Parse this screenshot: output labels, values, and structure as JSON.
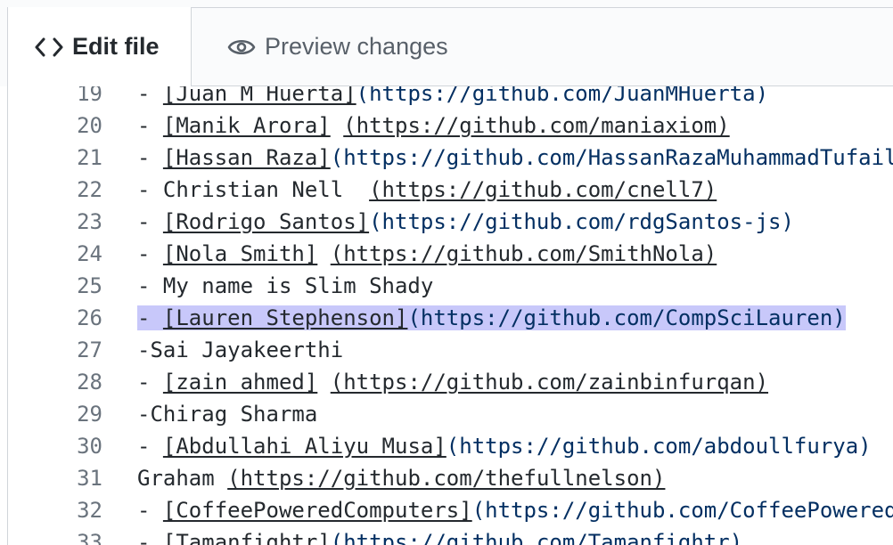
{
  "tabs": {
    "edit_label": "Edit file",
    "preview_label": "Preview changes"
  },
  "lines": [
    {
      "num": "19",
      "pre": "- ",
      "link": "[Juan M Huerta]",
      "mid": "",
      "url": "(https://github.com/JuanMHuerta)",
      "url_style": "url"
    },
    {
      "num": "20",
      "pre": "- ",
      "link": "[Manik Arora]",
      "mid": " ",
      "url": "(https://github.com/maniaxiom)",
      "url_style": "plain-underline"
    },
    {
      "num": "21",
      "pre": "- ",
      "link": "[Hassan Raza]",
      "mid": "",
      "url": "(https://github.com/HassanRazaMuhammadTufail)",
      "url_style": "url"
    },
    {
      "num": "22",
      "pre": "- Christian Nell  ",
      "link": "",
      "mid": "",
      "url": "(https://github.com/cnell7)",
      "url_style": "plain-underline"
    },
    {
      "num": "23",
      "pre": "- ",
      "link": "[Rodrigo Santos]",
      "mid": "",
      "url": "(https://github.com/rdgSantos-js)",
      "url_style": "url"
    },
    {
      "num": "24",
      "pre": "- ",
      "link": "[Nola Smith]",
      "mid": " ",
      "url": "(https://github.com/SmithNola)",
      "url_style": "plain-underline"
    },
    {
      "num": "25",
      "pre": "- My name is Slim Shady",
      "link": "",
      "mid": "",
      "url": "",
      "url_style": "none"
    },
    {
      "num": "26",
      "pre": "- ",
      "link": "[Lauren Stephenson]",
      "mid": "",
      "url": "(https://github.com/CompSciLauren)",
      "url_style": "url",
      "highlighted": true
    },
    {
      "num": "27",
      "pre": "-Sai Jayakeerthi",
      "link": "",
      "mid": "",
      "url": "",
      "url_style": "none"
    },
    {
      "num": "28",
      "pre": "- ",
      "link": "[zain ahmed]",
      "mid": " ",
      "url": "(https://github.com/zainbinfurqan)",
      "url_style": "plain-underline"
    },
    {
      "num": "29",
      "pre": "-Chirag Sharma",
      "link": "",
      "mid": "",
      "url": "",
      "url_style": "none"
    },
    {
      "num": "30",
      "pre": "- ",
      "link": "[Abdullahi Aliyu Musa]",
      "mid": "",
      "url": "(https://github.com/abdoullfurya)",
      "url_style": "url"
    },
    {
      "num": "31",
      "pre": "Graham ",
      "link": "",
      "mid": "",
      "url": "(https://github.com/thefullnelson)",
      "url_style": "plain-underline"
    },
    {
      "num": "32",
      "pre": "- ",
      "link": "[CoffeePoweredComputers]",
      "mid": "",
      "url": "(https://github.com/CoffeePoweredComputers)",
      "url_style": "url"
    },
    {
      "num": "33",
      "pre": "- ",
      "link": "[Tamanfightr]",
      "mid": "",
      "url": "(https://github.com/Tamanfightr)",
      "url_style": "url"
    }
  ],
  "icons": {
    "edit": "code-icon",
    "preview": "eye-icon"
  }
}
